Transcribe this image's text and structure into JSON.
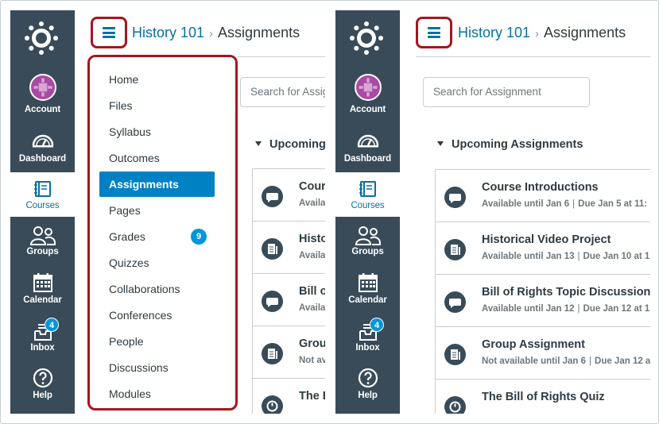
{
  "global_nav": {
    "account_label": "Account",
    "dashboard_label": "Dashboard",
    "courses_label": "Courses",
    "groups_label": "Groups",
    "calendar_label": "Calendar",
    "inbox_label": "Inbox",
    "inbox_badge": "4",
    "help_label": "Help"
  },
  "header": {
    "course_link": "History 101",
    "separator": "›",
    "page": "Assignments"
  },
  "search": {
    "placeholder": "Search for Assignment",
    "left_placeholder": "Search for Assig"
  },
  "upcoming": {
    "title": "Upcoming Assignments",
    "left_title": "Upcoming"
  },
  "assignments": [
    {
      "title": "Course Introductions",
      "left_title": "Cour",
      "available": "Available until Jan 6",
      "left_available": "Availa",
      "due": "Due Jan 5 at 11:",
      "icon": "discussion-icon"
    },
    {
      "title": "Historical Video Project",
      "left_title": "Histo",
      "available": "Available until Jan 13",
      "left_available": "Availa",
      "due": "Due Jan 10 at 1",
      "icon": "assignment-icon"
    },
    {
      "title": "Bill of Rights Topic Discussion",
      "left_title": "Bill o",
      "available": "Available until Jan 12",
      "left_available": "Availa",
      "due": "Due Jan 12 at 1",
      "icon": "discussion-icon"
    },
    {
      "title": "Group Assignment",
      "left_title": "Group",
      "available": "Not available until Jan 6",
      "left_available": "Not av",
      "due": "Due Jan 12 a",
      "icon": "assignment-icon"
    },
    {
      "title": "The Bill of Rights Quiz",
      "left_title": "The B",
      "available": "",
      "left_available": "",
      "due": "",
      "icon": "quiz-icon"
    }
  ],
  "course_nav": {
    "items": [
      {
        "label": "Home"
      },
      {
        "label": "Files"
      },
      {
        "label": "Syllabus"
      },
      {
        "label": "Outcomes"
      },
      {
        "label": "Assignments",
        "active": true
      },
      {
        "label": "Pages"
      },
      {
        "label": "Grades",
        "badge": "9"
      },
      {
        "label": "Quizzes"
      },
      {
        "label": "Collaborations"
      },
      {
        "label": "Conferences"
      },
      {
        "label": "People"
      },
      {
        "label": "Discussions"
      },
      {
        "label": "Modules"
      }
    ]
  },
  "colors": {
    "nav_bg": "#394b58",
    "link": "#0770a3",
    "active_item": "#0081c3",
    "highlight_border": "#a3171e",
    "badge": "#0096db"
  }
}
